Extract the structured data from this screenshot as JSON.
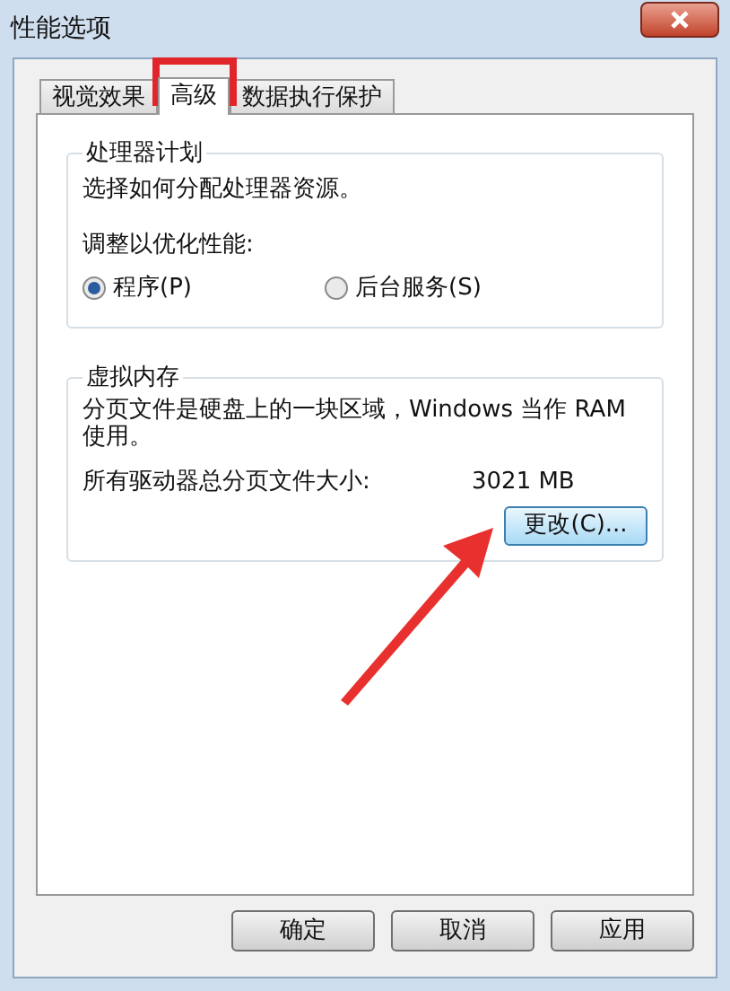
{
  "window": {
    "title": "性能选项"
  },
  "tabs": [
    {
      "label": "视觉效果",
      "selected": false
    },
    {
      "label": "高级",
      "selected": true
    },
    {
      "label": "数据执行保护",
      "selected": false
    }
  ],
  "processor_group": {
    "title": "处理器计划",
    "description": "选择如何分配处理器资源。",
    "adjust_label": "调整以优化性能:",
    "options": [
      {
        "label": "程序(P)",
        "selected": true
      },
      {
        "label": "后台服务(S)",
        "selected": false
      }
    ]
  },
  "virtual_memory_group": {
    "title": "虚拟内存",
    "description": "分页文件是硬盘上的一块区域，Windows 当作 RAM 使用。",
    "total_label": "所有驱动器总分页文件大小:",
    "total_value": "3021 MB",
    "change_button": "更改(C)..."
  },
  "buttons": [
    "确定",
    "取消",
    "应用"
  ]
}
